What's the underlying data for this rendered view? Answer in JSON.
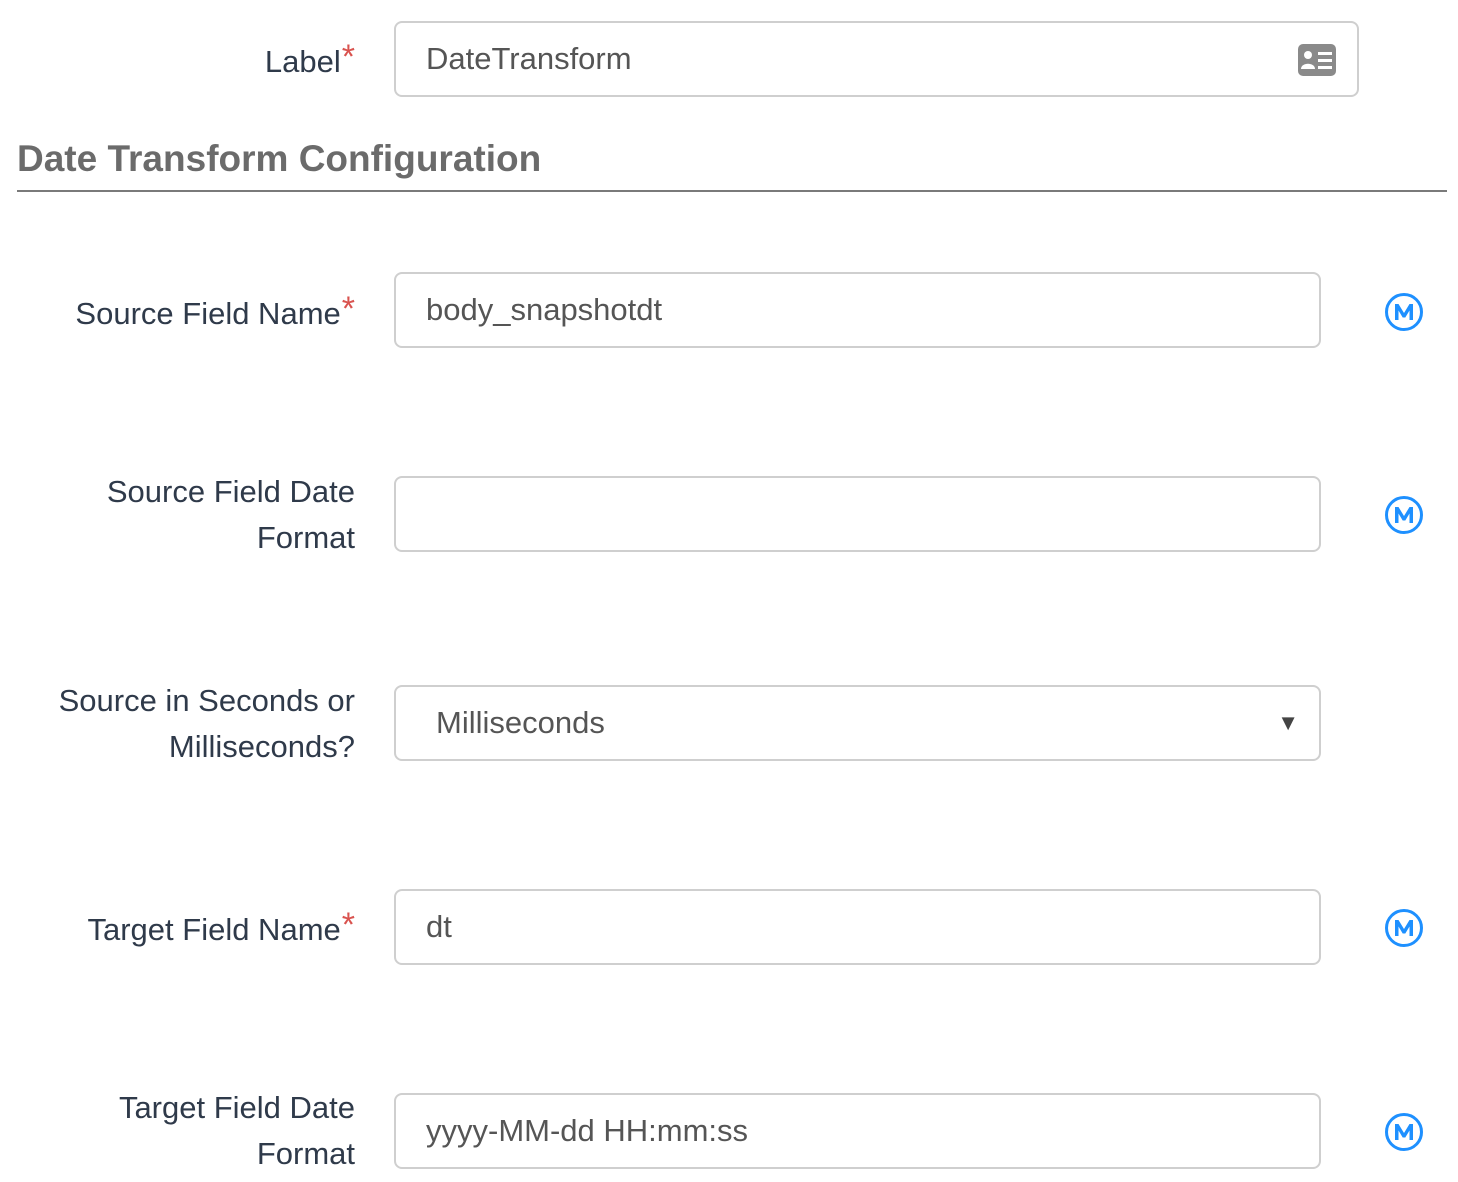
{
  "label_row": {
    "label": "Label",
    "required": "*",
    "value": "DateTransform",
    "icon": "contact-card-icon"
  },
  "section": {
    "title": "Date Transform Configuration"
  },
  "fields": {
    "source_field_name": {
      "label": "Source Field Name",
      "required": "*",
      "value": "body_snapshotdt",
      "icon": "mapper-icon"
    },
    "source_field_date_format": {
      "label_line1": "Source Field Date",
      "label_line2": "Format",
      "value": "",
      "icon": "mapper-icon"
    },
    "source_unit": {
      "label_line1": "Source in Seconds or",
      "label_line2": "Milliseconds?",
      "selected": "Milliseconds",
      "arrow": "▼"
    },
    "target_field_name": {
      "label": "Target Field Name",
      "required": "*",
      "value": "dt",
      "icon": "mapper-icon"
    },
    "target_field_date_format": {
      "label_line1": "Target Field Date",
      "label_line2": "Format",
      "value": "yyyy-MM-dd HH:mm:ss",
      "icon": "mapper-icon"
    }
  },
  "colors": {
    "required": "#d9534f",
    "mapper_icon": "#1e90ff",
    "border": "#cfcfcf"
  }
}
